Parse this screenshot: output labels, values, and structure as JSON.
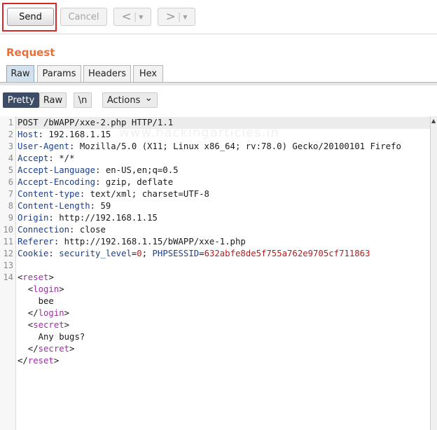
{
  "toolbar": {
    "send_label": "Send",
    "cancel_label": "Cancel",
    "back_arrow": "<",
    "forward_arrow": ">",
    "dropdown_glyph": "▼",
    "highlight_color": "#d62828"
  },
  "section_title": "Request",
  "tabs": [
    "Raw",
    "Params",
    "Headers",
    "Hex"
  ],
  "active_tab": "Raw",
  "view_buttons": {
    "pretty": "Pretty",
    "raw": "Raw",
    "newline": "\\n",
    "actions": "Actions",
    "actions_chevron": "⌄"
  },
  "line_numbers": [
    "1",
    "2",
    "3",
    "4",
    "5",
    "6",
    "7",
    "8",
    "9",
    "10",
    "11",
    "12",
    "13",
    "14"
  ],
  "request": {
    "request_line": "POST /bWAPP/xxe-2.php HTTP/1.1",
    "headers": [
      {
        "name": "Host",
        "value": "192.168.1.15"
      },
      {
        "name": "User-Agent",
        "value": "Mozilla/5.0 (X11; Linux x86_64; rv:78.0) Gecko/20100101 Firefo"
      },
      {
        "name": "Accept",
        "value": "*/*"
      },
      {
        "name": "Accept-Language",
        "value": "en-US,en;q=0.5"
      },
      {
        "name": "Accept-Encoding",
        "value": "gzip, deflate"
      },
      {
        "name": "Content-type",
        "value": "text/xml; charset=UTF-8"
      },
      {
        "name": "Content-Length",
        "value": "59"
      },
      {
        "name": "Origin",
        "value": "http://192.168.1.15"
      },
      {
        "name": "Connection",
        "value": "close"
      },
      {
        "name": "Referer",
        "value": "http://192.168.1.15/bWAPP/xxe-1.php"
      }
    ],
    "cookie": {
      "name": "Cookie",
      "p1_name": "security_level",
      "p1_value": "0",
      "p2_name": "PHPSESSID",
      "p2_value": "632abfe8de5f755a762e9705cf711863"
    },
    "body": {
      "root_tag": "reset",
      "login_tag": "login",
      "login_value": "bee",
      "secret_tag": "secret",
      "secret_value": "Any bugs?"
    }
  },
  "watermark": "www.hackingarticles.in",
  "colors": {
    "accent_orange": "#e8703a",
    "header_name": "#1b3f8a",
    "param_value": "#b31c1c",
    "xml_tag": "#9a2fa3",
    "active_pill": "#3c4c66",
    "active_tab": "#d3e0ee"
  }
}
